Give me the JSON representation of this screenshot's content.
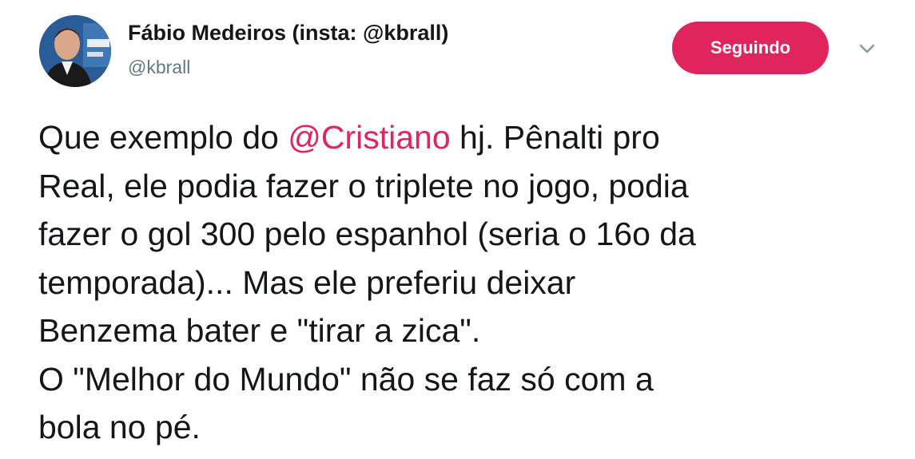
{
  "author": {
    "display_name": "Fábio Medeiros (insta: @kbrall)",
    "handle": "@kbrall"
  },
  "follow_button": {
    "label": "Seguindo"
  },
  "tweet": {
    "l1_before": "Que exemplo do ",
    "mention": "@Cristiano",
    "l1_after": " hj. Pênalti pro",
    "l2": "Real, ele podia fazer o triplete no jogo, podia",
    "l3": "fazer o gol 300 pelo espanhol (seria o 16o da",
    "l4": "temporada)... Mas ele preferiu deixar",
    "l5": "Benzema bater e \"tirar a zica\".",
    "l6": "O \"Melhor do Mundo\" não se faz só com a",
    "l7": "bola no pé."
  },
  "icons": {
    "avatar": "profile-photo",
    "caret": "chevron-down-icon"
  },
  "colors": {
    "accent": "#e0245e",
    "text": "#14171a",
    "secondary": "#657786"
  }
}
